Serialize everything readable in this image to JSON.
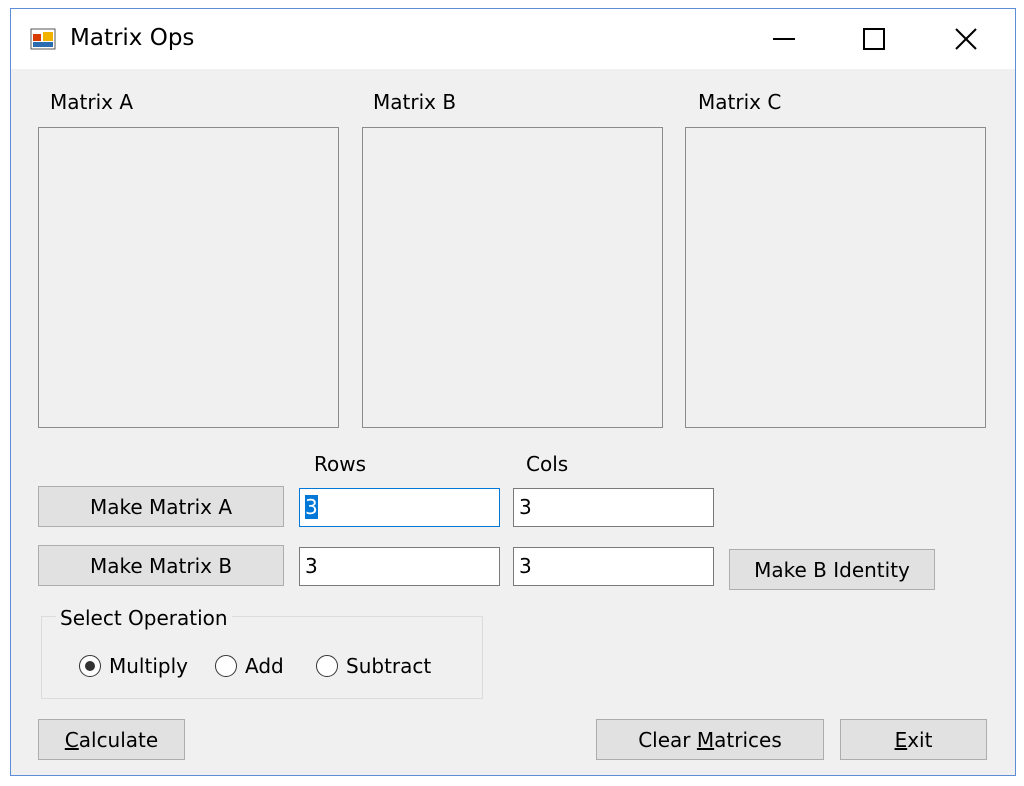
{
  "window": {
    "title": "Matrix Ops"
  },
  "matrices": {
    "a_label": "Matrix A",
    "b_label": "Matrix B",
    "c_label": "Matrix C"
  },
  "dims": {
    "rows_label": "Rows",
    "cols_label": "Cols",
    "a_rows": "3",
    "a_cols": "3",
    "b_rows": "3",
    "b_cols": "3"
  },
  "buttons": {
    "make_a": "Make Matrix A",
    "make_b": "Make Matrix B",
    "make_b_identity": "Make B Identity",
    "calculate_u": "C",
    "calculate_rest": "alculate",
    "clear_pre": "Clear ",
    "clear_u": "M",
    "clear_rest": "atrices",
    "exit_u": "E",
    "exit_rest": "xit"
  },
  "operation": {
    "legend": "Select Operation",
    "options": [
      "Multiply",
      "Add",
      "Subtract"
    ],
    "selected": "Multiply"
  },
  "icons": {
    "app": "app-window-icon",
    "minimize": "minimize-icon",
    "maximize": "maximize-icon",
    "close": "close-icon"
  }
}
